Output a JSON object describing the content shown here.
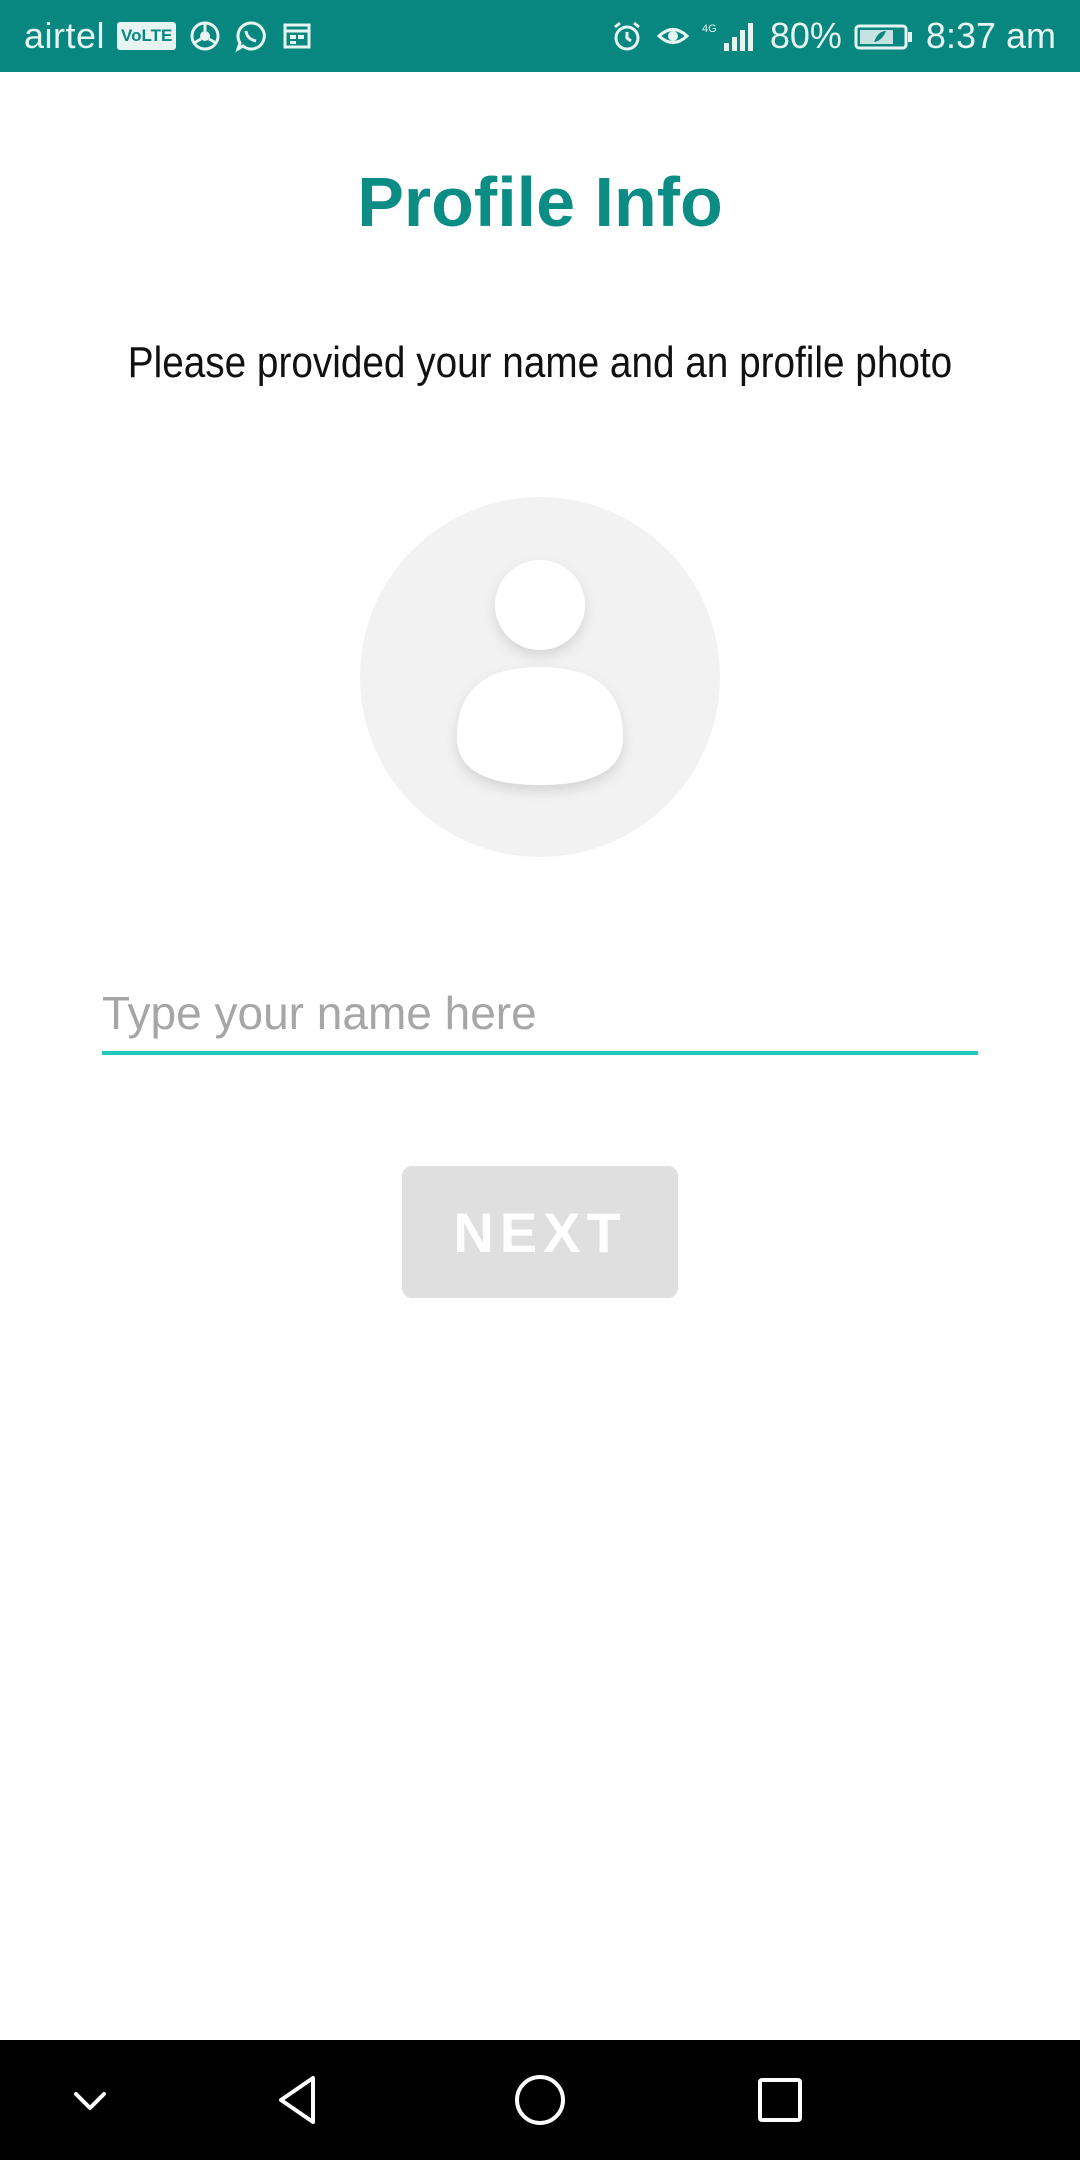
{
  "status_bar": {
    "carrier": "airtel",
    "volte": "VoLTE",
    "network": "4G",
    "battery": "80%",
    "time": "8:37 am",
    "icons_left": [
      "volte-icon",
      "chrome-icon",
      "whatsapp-icon",
      "calendar-icon"
    ],
    "icons_right": [
      "alarm-icon",
      "eye-icon",
      "signal-icon",
      "battery-icon"
    ]
  },
  "page": {
    "title": "Profile Info",
    "subtitle": "Please provided your name and an profile photo"
  },
  "avatar": {
    "icon": "person-icon"
  },
  "name_input": {
    "placeholder": "Type your name here",
    "value": ""
  },
  "next_button": {
    "label": "NEXT"
  },
  "nav_bar": {
    "icons": [
      "chevron-down-icon",
      "back-icon",
      "home-icon",
      "recents-icon"
    ]
  },
  "colors": {
    "status_bar": "#07877f",
    "title": "#0b8c84",
    "input_underline": "#1fc8bd",
    "button_disabled": "#dfdfdf",
    "avatar_bg": "#f2f2f3"
  }
}
